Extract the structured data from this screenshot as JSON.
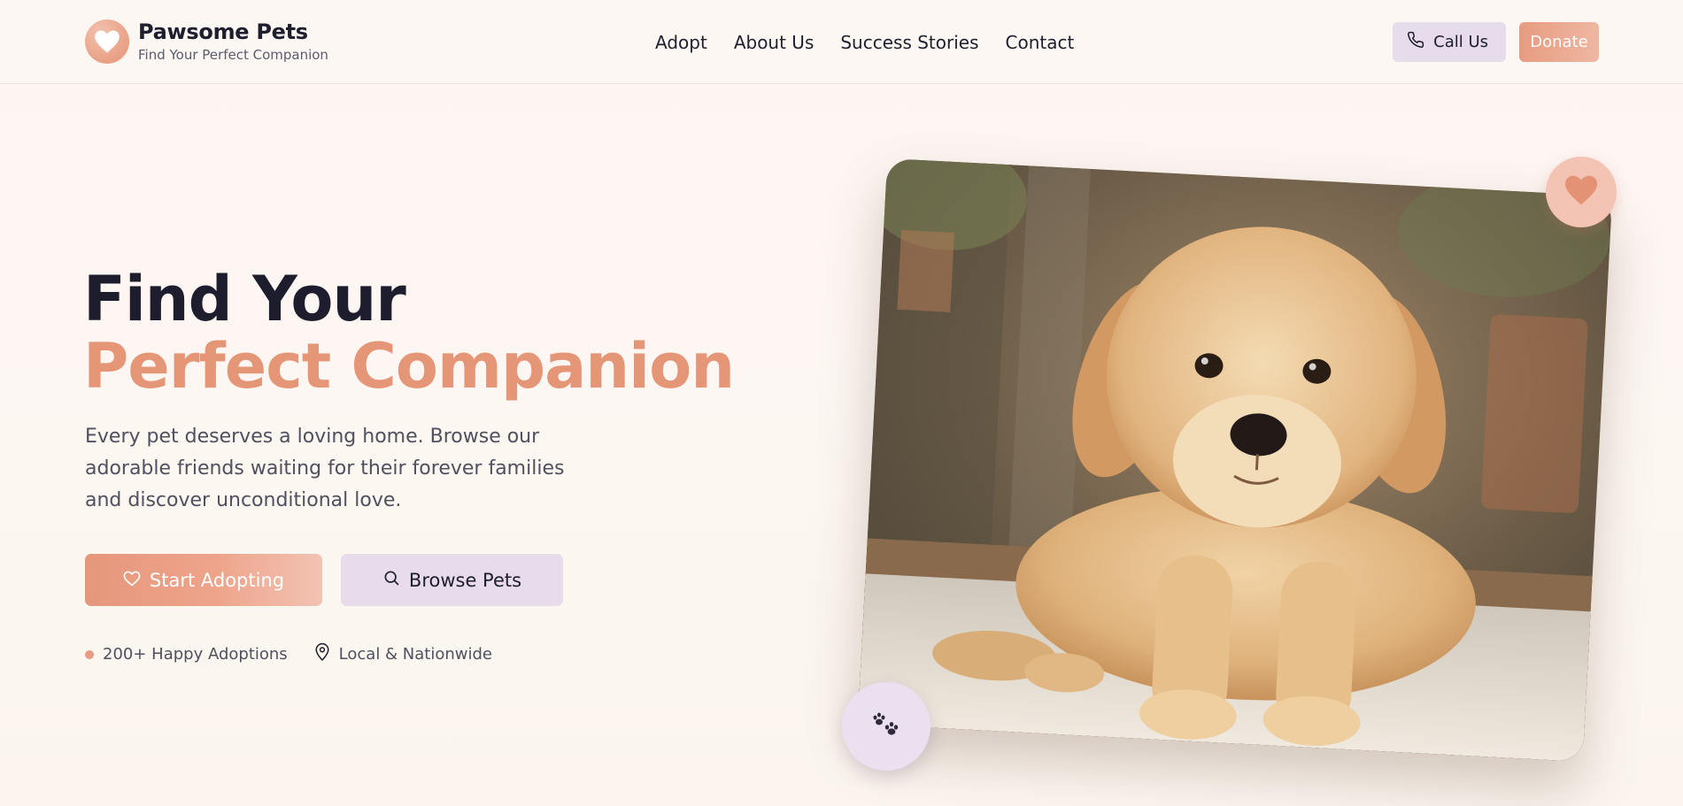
{
  "brand": {
    "name": "Pawsome Pets",
    "tagline": "Find Your Perfect Companion"
  },
  "nav": {
    "items": [
      {
        "label": "Adopt"
      },
      {
        "label": "About Us"
      },
      {
        "label": "Success Stories"
      },
      {
        "label": "Contact"
      }
    ]
  },
  "header_actions": {
    "call_label": "Call Us",
    "donate_label": "Donate"
  },
  "hero": {
    "title_line1": "Find Your",
    "title_line2": "Perfect Companion",
    "description": "Every pet deserves a loving home. Browse our adorable friends waiting for their forever families and discover unconditional love.",
    "primary_button": "Start Adopting",
    "secondary_button": "Browse Pets",
    "meta": [
      {
        "label": "200+ Happy Adoptions",
        "icon": "dot-icon"
      },
      {
        "label": "Local & Nationwide",
        "icon": "map-pin-icon"
      }
    ],
    "photo_subject": "golden retriever puppy"
  },
  "colors": {
    "accent": "#e49677",
    "accent_light": "#f3c3b3",
    "lavender": "#e8dcec",
    "text_dark": "#1d1d2d",
    "text_muted": "#50505f",
    "background": "#fdf5f2"
  },
  "icons": {
    "logo": "heart-icon",
    "call": "phone-icon",
    "primary_button": "heart-outline-icon",
    "secondary_button": "search-icon",
    "favorite_badge": "heart-icon",
    "paw_badge": "paw-icon"
  }
}
